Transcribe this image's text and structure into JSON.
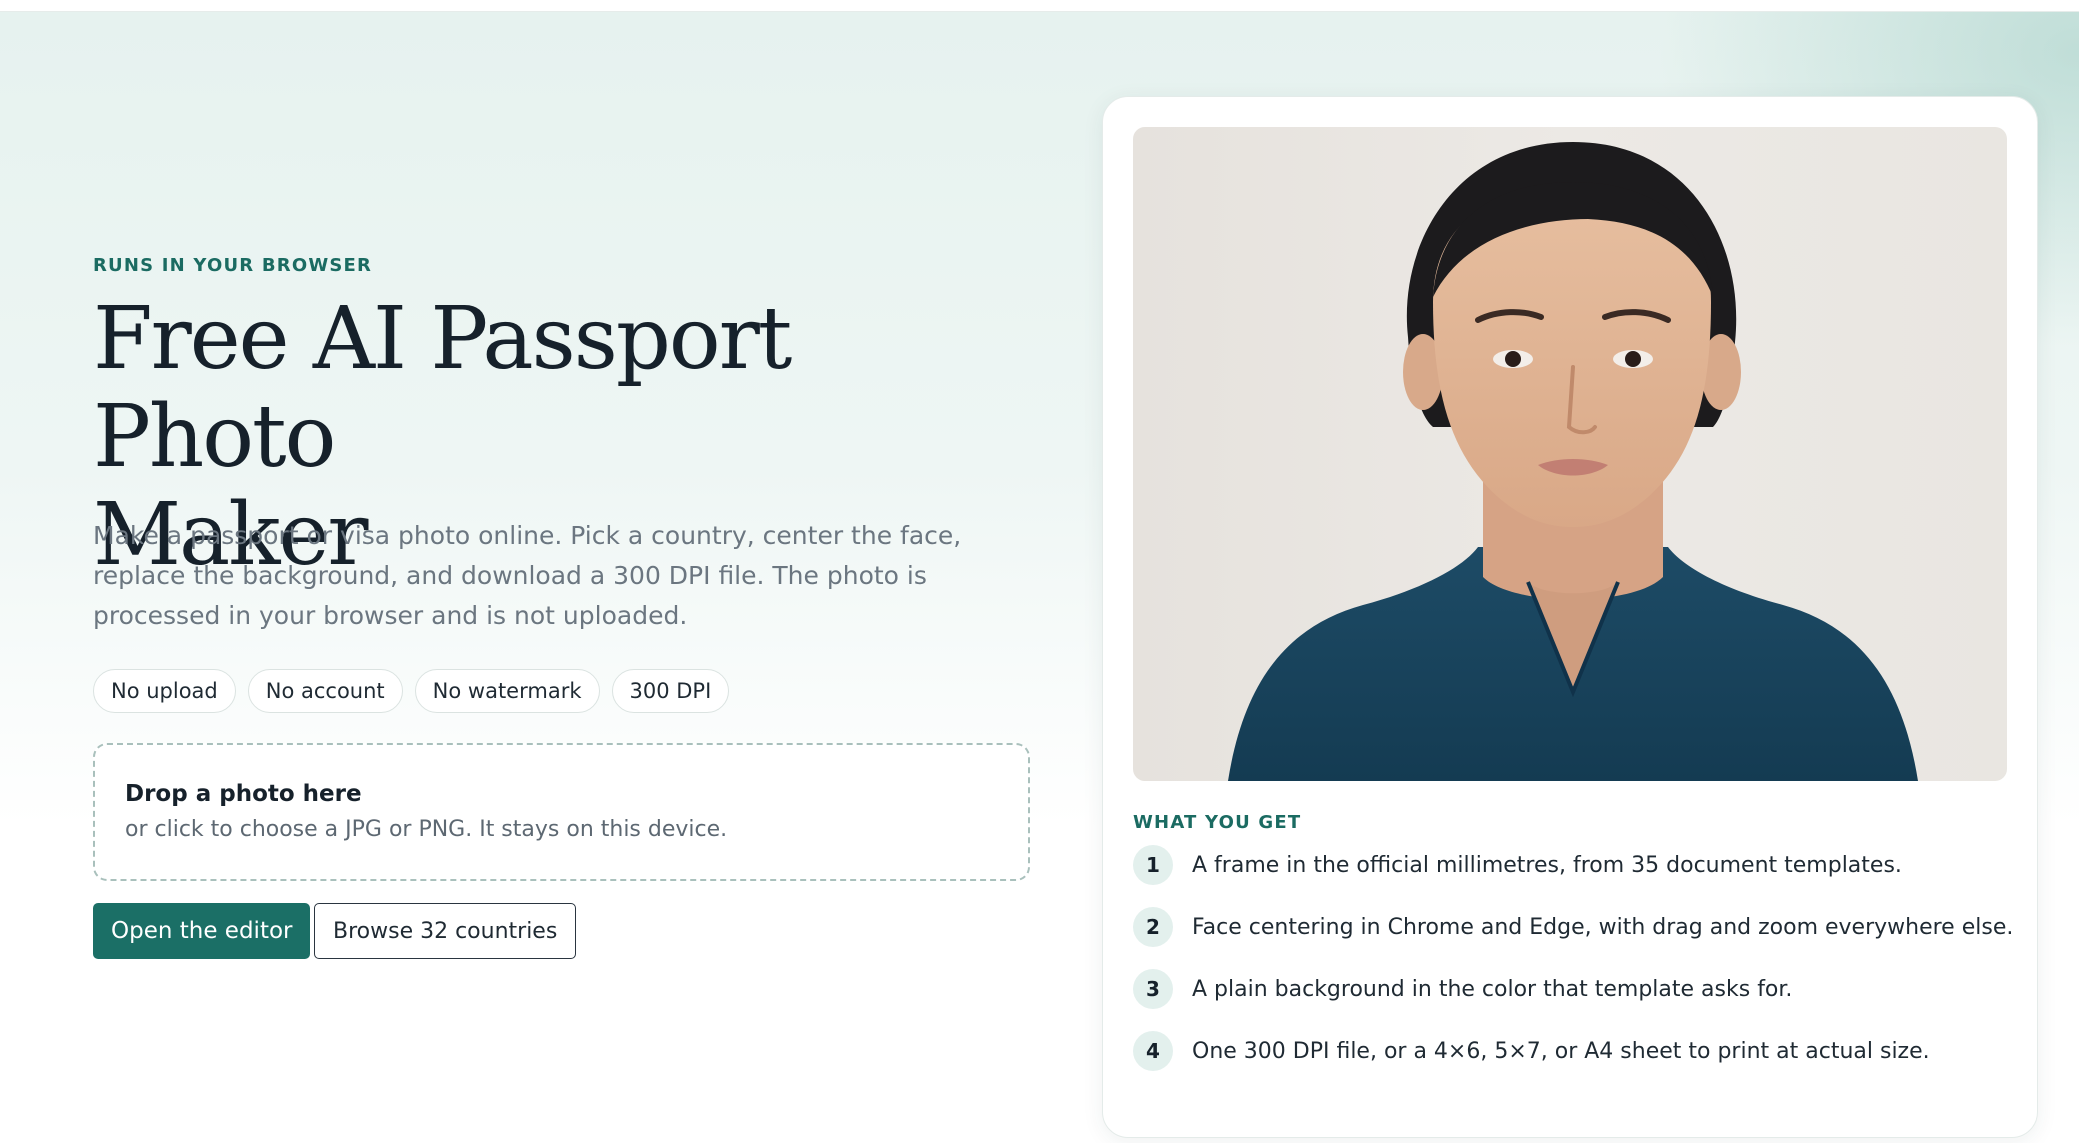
{
  "hero": {
    "eyebrow": "RUNS IN YOUR BROWSER",
    "title_line1": "Free AI Passport Photo",
    "title_line2": "Maker",
    "subtitle": "Make a passport or visa photo online. Pick a country, center the face, replace the background, and download a 300 DPI file. The photo is processed in your browser and is not uploaded.",
    "chips": [
      "No upload",
      "No account",
      "No watermark",
      "300 DPI"
    ],
    "dropzone": {
      "title": "Drop a photo here",
      "subtitle": "or click to choose a JPG or PNG. It stays on this device."
    },
    "primary_button": "Open the editor",
    "secondary_button": "Browse 32 countries"
  },
  "card": {
    "photo_icon": "sample-portrait-photo",
    "what_you_get_label": "WHAT YOU GET",
    "features": [
      {
        "num": "1",
        "text": "A frame in the official millimetres, from 35 document templates."
      },
      {
        "num": "2",
        "text": "Face centering in Chrome and Edge, with drag and zoom everywhere else."
      },
      {
        "num": "3",
        "text": "A plain background in the color that template asks for."
      },
      {
        "num": "4",
        "text": "One 300 DPI file, or a 4×6, 5×7, or A4 sheet to print at actual size."
      }
    ]
  },
  "colors": {
    "accent": "#1b6f66",
    "eyebrow": "#1b6b62",
    "heading": "#16212b",
    "muted_text": "#6b7680"
  }
}
